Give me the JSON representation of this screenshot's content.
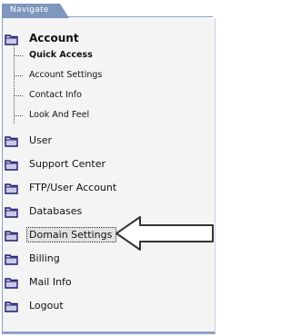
{
  "nav": {
    "title": "Navigate",
    "account": {
      "label": "Account",
      "sub_items": [
        {
          "label": "Quick Access"
        },
        {
          "label": "Account Settings"
        },
        {
          "label": "Contact Info"
        },
        {
          "label": "Look And Feel"
        }
      ]
    },
    "items": [
      {
        "label": "User"
      },
      {
        "label": "Support Center"
      },
      {
        "label": "FTP/User Account"
      },
      {
        "label": "Databases"
      },
      {
        "label": "Domain Settings"
      },
      {
        "label": "Billing"
      },
      {
        "label": "Mail Info"
      },
      {
        "label": "Logout"
      }
    ],
    "selected_item": "Domain Settings"
  },
  "colors": {
    "tab_bg": "#7f96bd",
    "folder_fill": "#c9c9e8",
    "folder_stroke": "#1c1c6b",
    "panel_bg": "#f4f4f4",
    "arrow_fill": "#ffffff",
    "arrow_stroke": "#333333"
  },
  "icons": {
    "folder": "folder-icon",
    "pointer": "pointer-arrow-icon"
  }
}
